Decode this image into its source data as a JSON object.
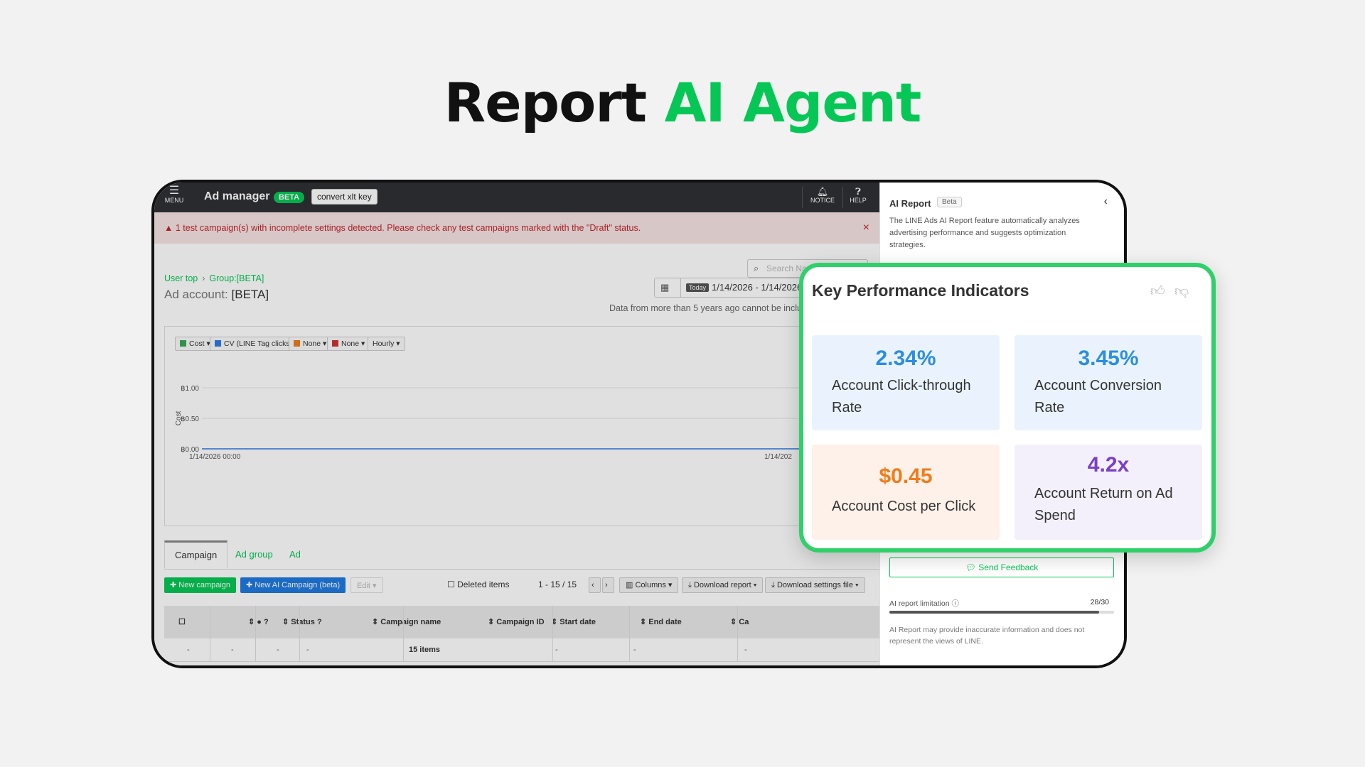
{
  "hero": {
    "title_main": "Report",
    "title_accent": "AI Agent"
  },
  "topbar": {
    "menu_label": "MENU",
    "app_title": "Ad manager",
    "beta_badge": "BETA",
    "convert_button": "convert xlt key",
    "notice_label": "NOTICE",
    "help_label": "HELP"
  },
  "alert": {
    "icon": "warning-icon",
    "message": "1 test campaign(s) with incomplete settings detected. Please check any test campaigns marked with the \"Draft\" status.",
    "close": "×"
  },
  "breadcrumb": {
    "items": [
      "User top",
      "Group:[BETA]"
    ],
    "separator": "›"
  },
  "account": {
    "label": "Ad account:",
    "value": "[BETA]"
  },
  "search": {
    "placeholder": "Search Na"
  },
  "date_picker": {
    "today_label": "Today",
    "range": "1/14/2026 - 1/14/2026"
  },
  "data_note": "Data from more than 5 years ago cannot be inclu",
  "chart_controls": [
    {
      "label": "Cost",
      "color": "#3aa655"
    },
    {
      "label": "CV (LINE Tag clicks)",
      "color": "#2c7be5"
    },
    {
      "label": "None",
      "color": "#f07c1a"
    },
    {
      "label": "None",
      "color": "#d0312d"
    },
    {
      "label": "Hourly",
      "color": ""
    }
  ],
  "chart_data": {
    "type": "line",
    "ylabel": "Cost",
    "ytick_labels": [
      "฿1.00",
      "฿0.50",
      "฿0.00"
    ],
    "yticks": [
      1.0,
      0.5,
      0.0
    ],
    "ylim": [
      0,
      1.0
    ],
    "x_labels": [
      "1/14/2026 00:00",
      "1/14/202"
    ],
    "series": [
      {
        "name": "Cost",
        "color": "#2c7be5",
        "values": [
          0,
          0
        ]
      }
    ],
    "grid": true
  },
  "tabs": [
    "Campaign",
    "Ad group",
    "Ad"
  ],
  "toolbar": {
    "new_campaign": "New campaign",
    "new_ai_campaign": "New AI Campaign (beta)",
    "edit": "Edit",
    "deleted_items": "Deleted items",
    "pagination": "1 - 15 / 15",
    "columns": "Columns",
    "download_report": "Download report",
    "download_settings": "Download settings file"
  },
  "table": {
    "headers": [
      "",
      "",
      "● ",
      "Status",
      "Campaign name",
      "Campaign ID",
      "Start date",
      "End date",
      "Ca"
    ],
    "summary_row": [
      "-",
      "-",
      "-",
      "-",
      "15 items",
      "-",
      "-",
      "-"
    ]
  },
  "side_panel": {
    "title": "AI Report",
    "beta": "Beta",
    "description": "The LINE Ads AI Report feature automatically analyzes advertising performance and suggests optimization strategies.",
    "feedback_button": "Send Feedback",
    "limit_label": "AI report limitation",
    "limit_count": "28/30",
    "limit_fraction": 0.933,
    "footer": "AI Report may provide inaccurate information and does not represent the views of LINE."
  },
  "kpi": {
    "title": "Key Performance Indicators",
    "tiles": [
      {
        "value": "2.34%",
        "label": "Account Click-through Rate",
        "value_color": "#2b8ee0",
        "bg": "#eaf3fd"
      },
      {
        "value": "3.45%",
        "label": "Account Conversion Rate",
        "value_color": "#2b8ee0",
        "bg": "#eaf3fd"
      },
      {
        "value": "$0.45",
        "label": "Account Cost per Click",
        "value_color": "#f07c1a",
        "bg": "#fdf1ea"
      },
      {
        "value": "4.2x",
        "label": "Account Return on Ad Spend",
        "value_color": "#7a3fc8",
        "bg": "#f3f0fb"
      }
    ]
  }
}
